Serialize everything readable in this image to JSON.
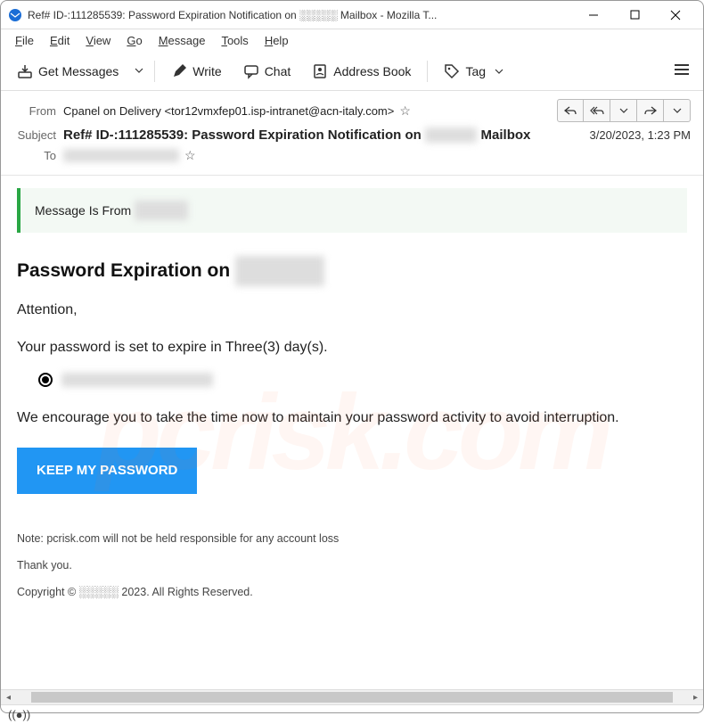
{
  "window": {
    "title": "Ref# ID-:111285539: Password Expiration Notification on ░░░░░ Mailbox - Mozilla T..."
  },
  "menubar": [
    "File",
    "Edit",
    "View",
    "Go",
    "Message",
    "Tools",
    "Help"
  ],
  "toolbar": {
    "get_messages": "Get Messages",
    "write": "Write",
    "chat": "Chat",
    "address_book": "Address Book",
    "tag": "Tag"
  },
  "header": {
    "from_label": "From",
    "from_value": "Cpanel on Delivery <tor12vmxfep01.isp-intranet@acn-italy.com>",
    "subject_label": "Subject",
    "subject_value_prefix": "Ref# ID-:111285539: Password Expiration Notification on ",
    "subject_value_suffix": " Mailbox",
    "to_label": "To",
    "date": "3/20/2023, 1:23 PM"
  },
  "body": {
    "banner_prefix": "Message Is From ",
    "title_prefix": "Password Expiration on ",
    "attention": "Attention,",
    "expire_line": "Your password is set to expire in Three(3)  day(s).",
    "encourage_line": "We encourage you to take the time now to maintain your password activity to avoid interruption.",
    "cta_label": "KEEP MY PASSWORD",
    "note_line": "Note: pcrisk.com    will not be held responsible for any account loss",
    "thank_you": "Thank you.",
    "copyright": "Copyright © ░░░░░ 2023. All Rights Reserved."
  },
  "statusbar": {
    "icon_name": "broadcast-icon"
  }
}
